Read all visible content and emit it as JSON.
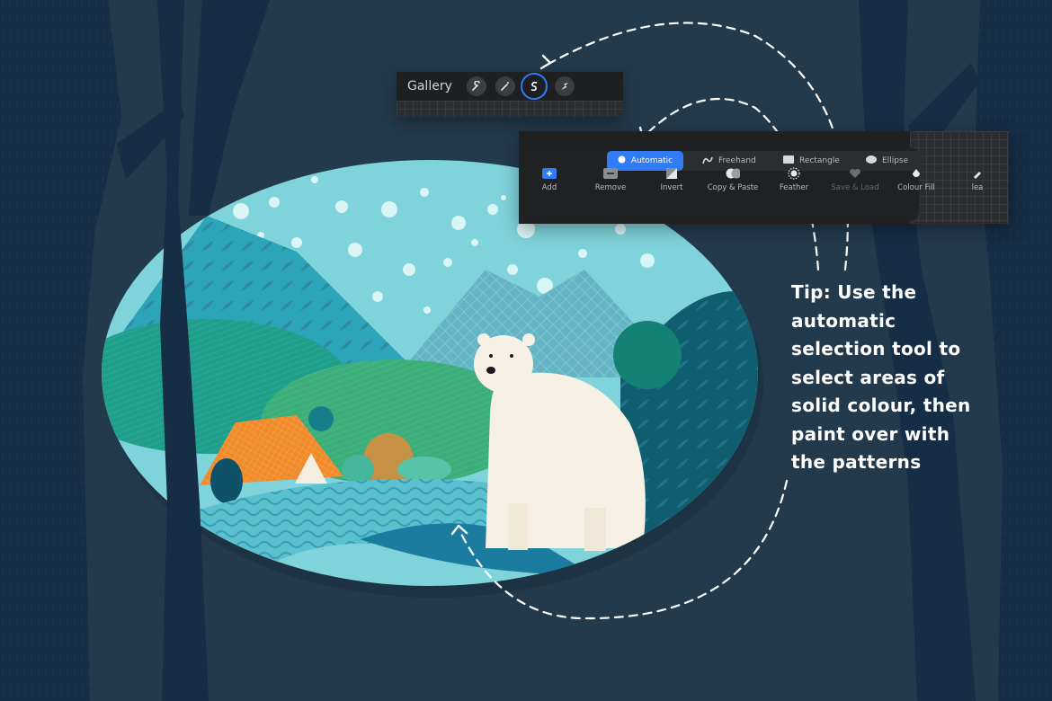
{
  "canvas": {
    "background": "#233a4d"
  },
  "toolbar": {
    "gallery_label": "Gallery",
    "tools": [
      {
        "icon": "wrench-icon",
        "active": false
      },
      {
        "icon": "magic-wand-icon",
        "active": false
      },
      {
        "icon": "selection-icon",
        "active": true
      },
      {
        "icon": "transform-arrow-icon",
        "active": false
      }
    ],
    "highlight_color": "#2f7cf6"
  },
  "selection_panel": {
    "modes": [
      {
        "label": "Automatic",
        "icon": "dot-icon",
        "active": true
      },
      {
        "label": "Freehand",
        "icon": "freehand-icon",
        "active": false
      },
      {
        "label": "Rectangle",
        "icon": "rectangle-icon",
        "active": false
      },
      {
        "label": "Ellipse",
        "icon": "ellipse-icon",
        "active": false
      }
    ],
    "actions": [
      {
        "label": "Add",
        "icon": "add-icon",
        "enabled": true
      },
      {
        "label": "Remove",
        "icon": "remove-icon",
        "enabled": true
      },
      {
        "label": "Invert",
        "icon": "invert-icon",
        "enabled": true
      },
      {
        "label": "Copy & Paste",
        "icon": "copy-paste-icon",
        "enabled": true
      },
      {
        "label": "Feather",
        "icon": "feather-icon",
        "enabled": true
      },
      {
        "label": "Save & Load",
        "icon": "heart-icon",
        "enabled": false
      },
      {
        "label": "Colour Fill",
        "icon": "colour-fill-icon",
        "enabled": true
      },
      {
        "label": "lea",
        "icon": "clear-icon",
        "enabled": true
      }
    ]
  },
  "tip": {
    "lines": [
      "Tip: Use the",
      "automatic",
      "selection tool to",
      "select areas of",
      "solid colour, then",
      "paint over with",
      "the patterns"
    ]
  },
  "illustration": {
    "subject": "polar-bear-icon"
  }
}
